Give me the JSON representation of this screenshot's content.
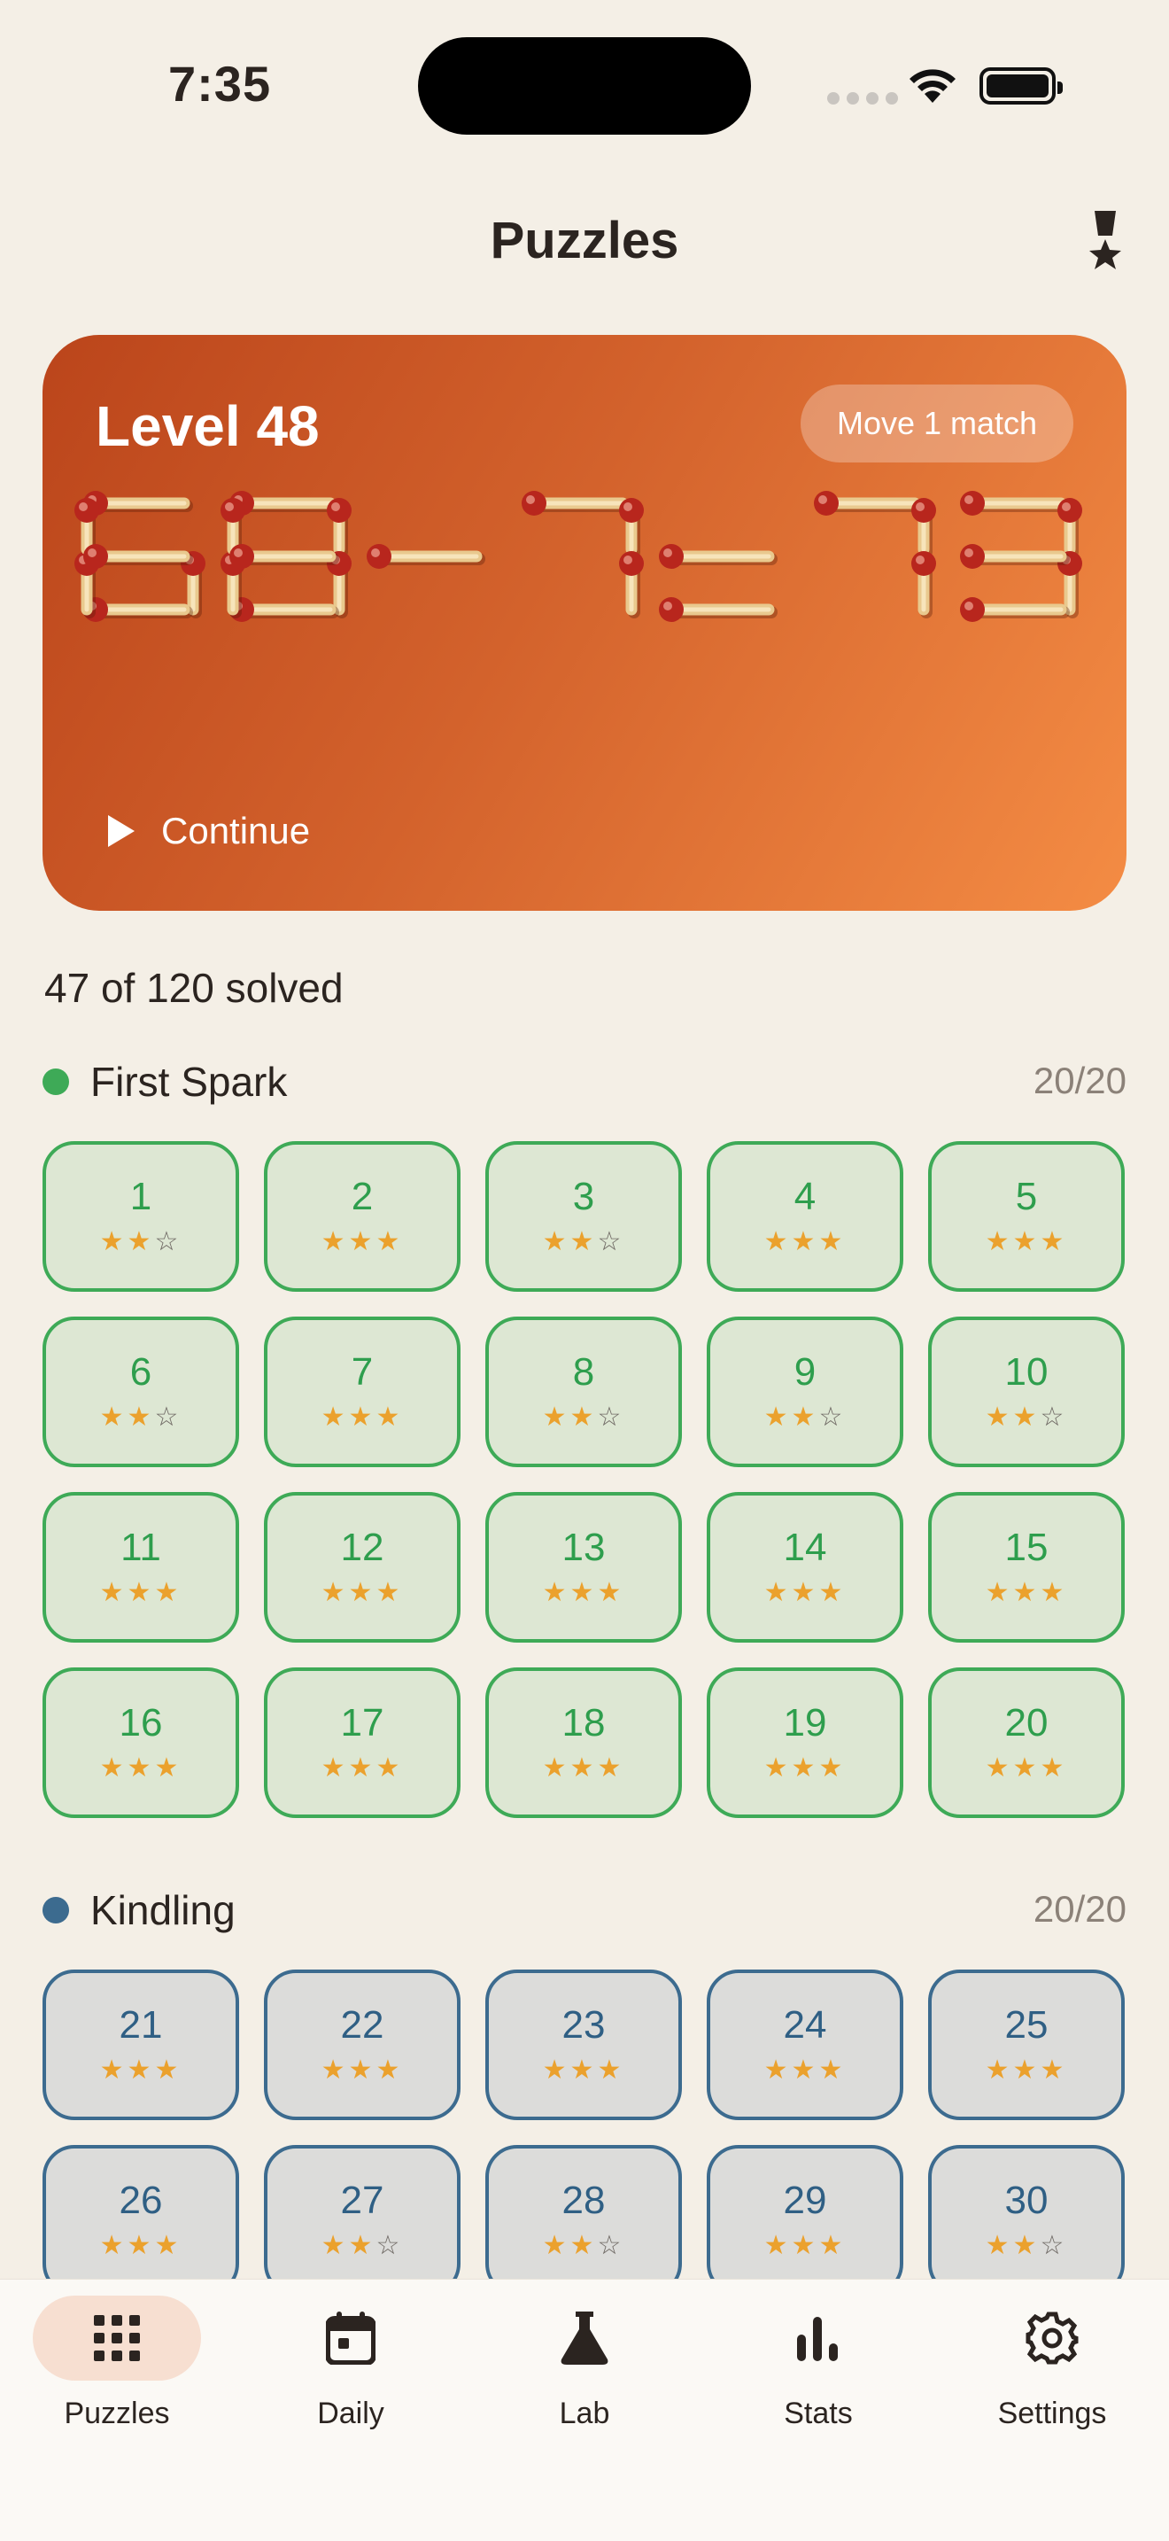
{
  "status_bar": {
    "time": "7:35"
  },
  "header": {
    "title": "Puzzles",
    "medal_icon": "medal-icon"
  },
  "hero": {
    "level": "Level 48",
    "badge": "Move 1 match",
    "equation": "68-7=73",
    "continue_label": "Continue",
    "gradient_start": "#bb451b",
    "gradient_end": "#f48c44"
  },
  "progress": {
    "solved_text": "47 of 120 solved"
  },
  "sections": [
    {
      "title": "First Spark",
      "count": "20/20",
      "color": "#3eaa57",
      "levels": [
        {
          "n": "1",
          "stars": 2
        },
        {
          "n": "2",
          "stars": 3
        },
        {
          "n": "3",
          "stars": 2
        },
        {
          "n": "4",
          "stars": 3
        },
        {
          "n": "5",
          "stars": 3
        },
        {
          "n": "6",
          "stars": 2
        },
        {
          "n": "7",
          "stars": 3
        },
        {
          "n": "8",
          "stars": 2
        },
        {
          "n": "9",
          "stars": 2
        },
        {
          "n": "10",
          "stars": 2
        },
        {
          "n": "11",
          "stars": 3
        },
        {
          "n": "12",
          "stars": 3
        },
        {
          "n": "13",
          "stars": 3
        },
        {
          "n": "14",
          "stars": 3
        },
        {
          "n": "15",
          "stars": 3
        },
        {
          "n": "16",
          "stars": 3
        },
        {
          "n": "17",
          "stars": 3
        },
        {
          "n": "18",
          "stars": 3
        },
        {
          "n": "19",
          "stars": 3
        },
        {
          "n": "20",
          "stars": 3
        }
      ]
    },
    {
      "title": "Kindling",
      "count": "20/20",
      "color": "#3c6b8f",
      "levels": [
        {
          "n": "21",
          "stars": 3
        },
        {
          "n": "22",
          "stars": 3
        },
        {
          "n": "23",
          "stars": 3
        },
        {
          "n": "24",
          "stars": 3
        },
        {
          "n": "25",
          "stars": 3
        },
        {
          "n": "26",
          "stars": 3
        },
        {
          "n": "27",
          "stars": 2
        },
        {
          "n": "28",
          "stars": 2
        },
        {
          "n": "29",
          "stars": 3
        },
        {
          "n": "30",
          "stars": 2
        }
      ]
    }
  ],
  "tabs": [
    {
      "label": "Puzzles",
      "icon": "grid-icon",
      "active": true
    },
    {
      "label": "Daily",
      "icon": "calendar-icon",
      "active": false
    },
    {
      "label": "Lab",
      "icon": "flask-icon",
      "active": false
    },
    {
      "label": "Stats",
      "icon": "bar-chart-icon",
      "active": false
    },
    {
      "label": "Settings",
      "icon": "gear-icon",
      "active": false
    }
  ]
}
